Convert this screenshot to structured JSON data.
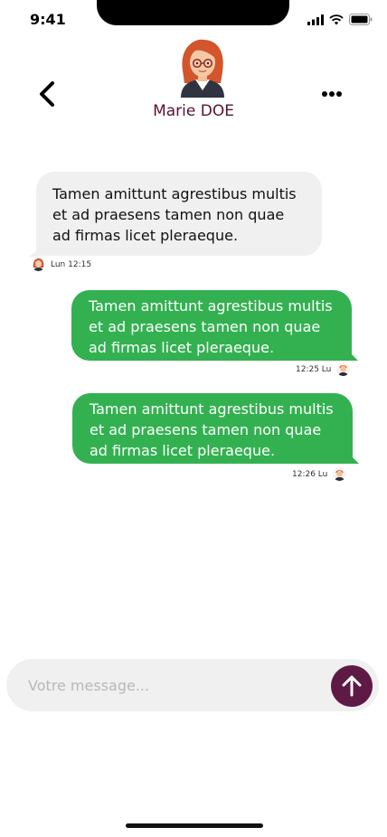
{
  "status_bar": {
    "time": "9:41"
  },
  "header": {
    "contact_name": "Marie DOE"
  },
  "messages": [
    {
      "direction": "received",
      "text": "Tamen amittunt agrestibus multis et ad praesens tamen non quae ad firmas licet pleraeque.",
      "time": "Lun 12:15"
    },
    {
      "direction": "sent",
      "text": "Tamen amittunt agrestibus multis et ad praesens tamen non quae ad firmas licet pleraeque.",
      "time": "12:25 Lu"
    },
    {
      "direction": "sent",
      "text": "Tamen amittunt agrestibus multis et ad praesens tamen non quae ad firmas licet pleraeque.",
      "time": "12:26 Lu"
    }
  ],
  "composer": {
    "placeholder": "Votre message..."
  },
  "colors": {
    "sent_bubble": "#33b151",
    "received_bubble": "#f0f0f0",
    "accent": "#5e1a45",
    "name": "#5c1030"
  },
  "icons": [
    "back-chevron-icon",
    "more-dots-icon",
    "send-arrow-up-icon",
    "signal-icon",
    "wifi-icon",
    "battery-icon"
  ]
}
